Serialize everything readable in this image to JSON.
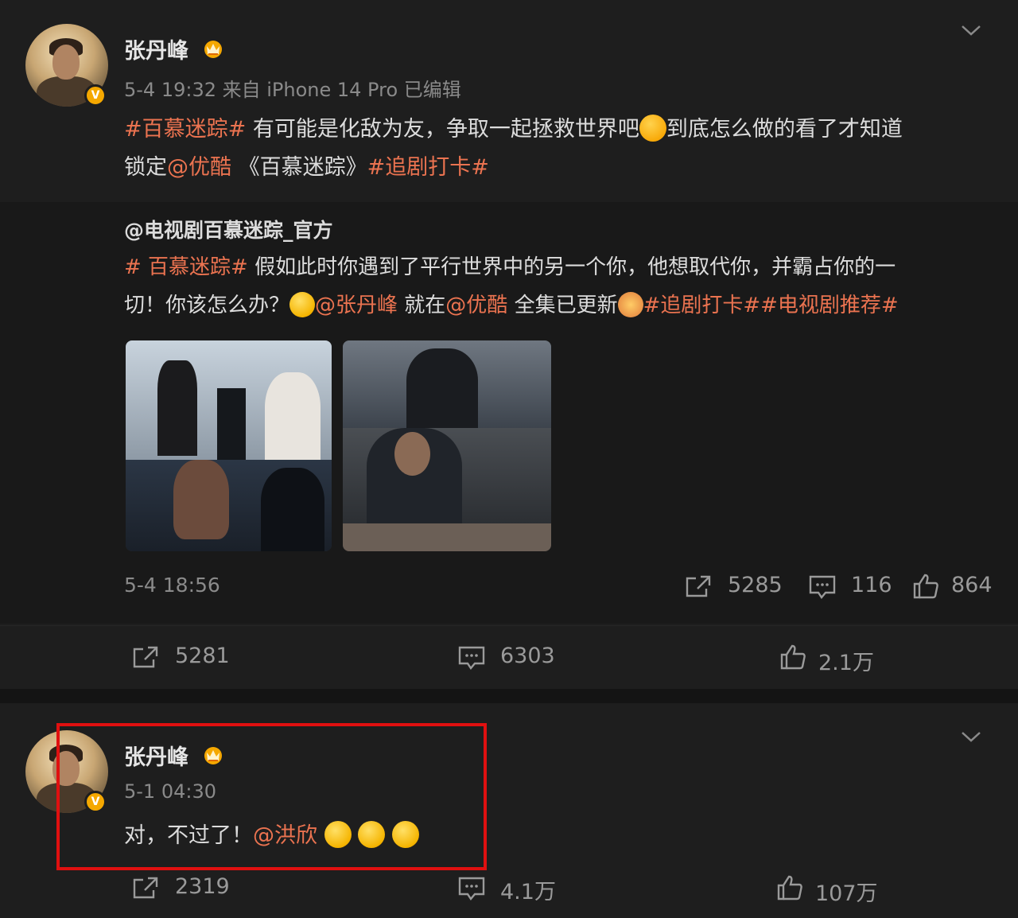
{
  "post1": {
    "username": "张丹峰",
    "meta": "5-4 19:32 来自 iPhone 14 Pro 已编辑",
    "line1": {
      "tag1": "#百慕迷踪#",
      "text1": " 有可能是化敌为友，争取一起拯救世界吧",
      "text2": "到底怎么做的看了才知道"
    },
    "line2": {
      "text1": "锁定",
      "mention": "@优酷",
      "text2": " 《百慕迷踪》",
      "tag2": "#追剧打卡#"
    },
    "repost": {
      "author": "@电视剧百慕迷踪_官方",
      "line1_tag": "# 百慕迷踪#",
      "line1_text": " 假如此时你遇到了平行世界中的另一个你，他想取代你，并霸占你的一",
      "line2_text1": "切！你该怎么办？",
      "line2_mention1": "@张丹峰",
      "line2_text2": " 就在",
      "line2_mention2": "@优酷",
      "line2_text3": " 全集已更新",
      "line2_tags": "#追剧打卡##电视剧推荐#",
      "time": "5-4 18:56",
      "share": "5285",
      "comment": "116",
      "like": "864"
    },
    "stats": {
      "share": "5281",
      "comment": "6303",
      "like": "2.1万"
    }
  },
  "post2": {
    "username": "张丹峰",
    "meta": "5-1 04:30",
    "text": "对，不过了！",
    "mention": "@洪欣",
    "stats": {
      "share": "2319",
      "comment": "4.1万",
      "like": "107万"
    }
  },
  "colors": {
    "accent": "#eb7350",
    "highlight": "#e01010",
    "vip_badge": "#f5a800"
  },
  "icons": [
    "crown-icon",
    "verified-badge-icon",
    "chevron-down-icon",
    "share-icon",
    "comment-icon",
    "like-icon",
    "emoji-icon"
  ]
}
